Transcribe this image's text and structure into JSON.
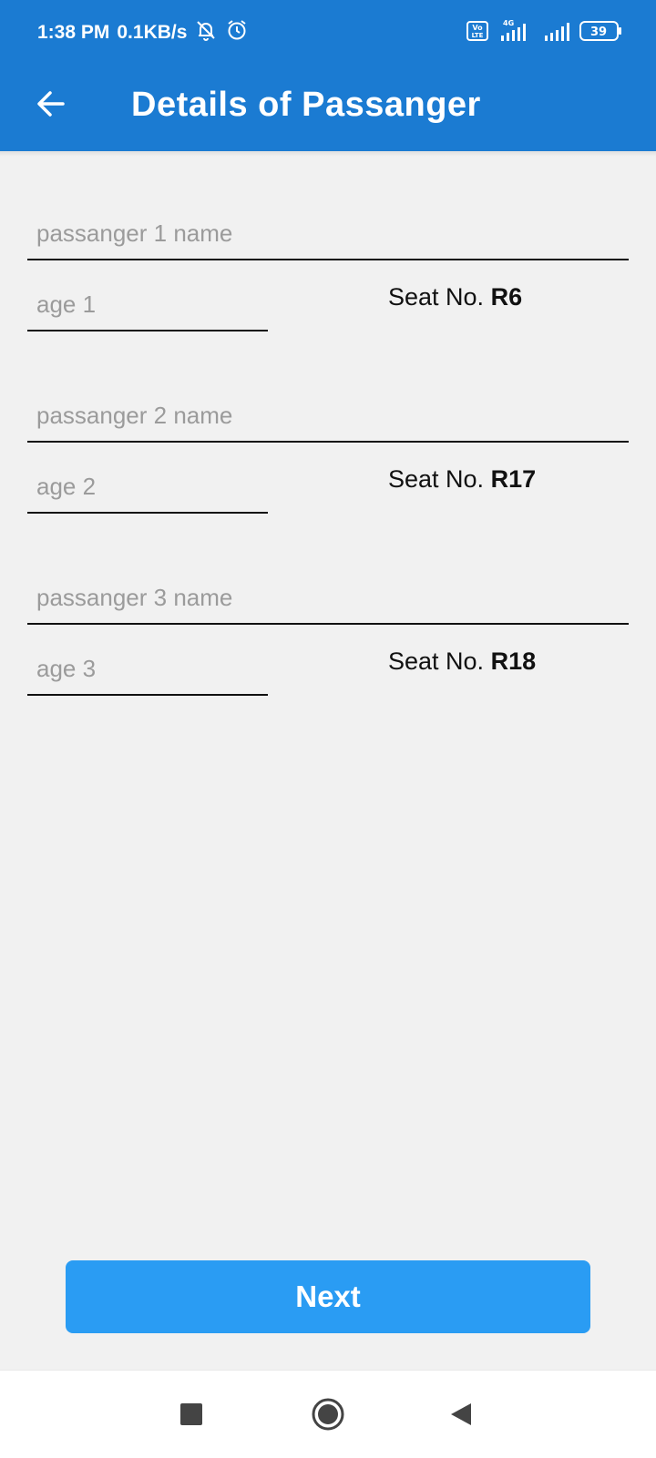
{
  "status_bar": {
    "time": "1:38 PM",
    "speed": "0.1KB/s",
    "network_label": "4G",
    "volte_label": "Vo LTE",
    "battery": "39",
    "icons": [
      "bell-off-icon",
      "alarm-icon",
      "volte-icon",
      "signal-icon",
      "battery-icon"
    ]
  },
  "header": {
    "title": "Details of Passanger",
    "back_icon": "arrow-left-icon",
    "background_color": "#1b7bd2"
  },
  "passengers": [
    {
      "name_placeholder": "passanger 1 name",
      "name_value": "",
      "age_placeholder": "age 1",
      "age_value": "",
      "seat_label": "Seat No.",
      "seat_value": "R6"
    },
    {
      "name_placeholder": "passanger 2 name",
      "name_value": "",
      "age_placeholder": "age 2",
      "age_value": "",
      "seat_label": "Seat No.",
      "seat_value": "R17"
    },
    {
      "name_placeholder": "passanger 3 name",
      "name_value": "",
      "age_placeholder": "age 3",
      "age_value": "",
      "seat_label": "Seat No.",
      "seat_value": "R18"
    }
  ],
  "next_button": {
    "label": "Next",
    "color": "#2a9cf3"
  },
  "nav_bar": {
    "icons": [
      "recents-square-icon",
      "home-circle-icon",
      "back-triangle-icon"
    ]
  }
}
